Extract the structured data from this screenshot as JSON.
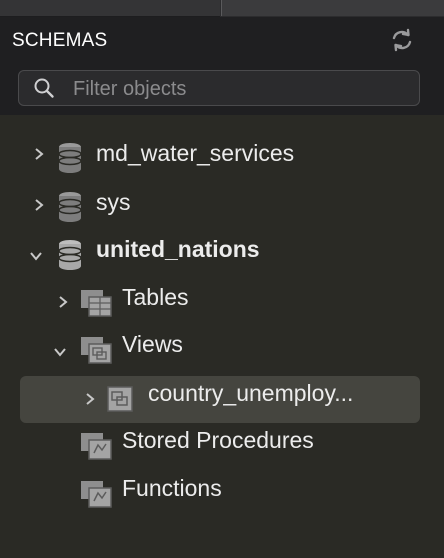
{
  "tabs": [
    {
      "label": ""
    },
    {
      "label": ""
    }
  ],
  "header": {
    "title": "SCHEMAS",
    "refresh_icon": "refresh-icon"
  },
  "filter": {
    "placeholder": "Filter objects",
    "value": ""
  },
  "tree": {
    "items": [
      {
        "label": "md_water_services",
        "icon": "database-icon",
        "expanded": false,
        "bold": false
      },
      {
        "label": "sys",
        "icon": "database-icon",
        "expanded": false,
        "bold": false
      },
      {
        "label": "united_nations",
        "icon": "database-icon",
        "expanded": true,
        "bold": true
      },
      {
        "label": "Tables",
        "icon": "tables-folder-icon",
        "expanded": false,
        "bold": false
      },
      {
        "label": "Views",
        "icon": "views-folder-icon",
        "expanded": true,
        "bold": false
      },
      {
        "label": "country_unemploy...",
        "icon": "view-icon",
        "expanded": false,
        "bold": false,
        "selected": true
      },
      {
        "label": "Stored Procedures",
        "icon": "procedures-folder-icon",
        "bold": false
      },
      {
        "label": "Functions",
        "icon": "functions-folder-icon",
        "bold": false
      }
    ]
  },
  "colors": {
    "background": "#2a2a25",
    "header_background": "#1f1f21",
    "selected_row": "#45453f",
    "text": "#ececec"
  }
}
